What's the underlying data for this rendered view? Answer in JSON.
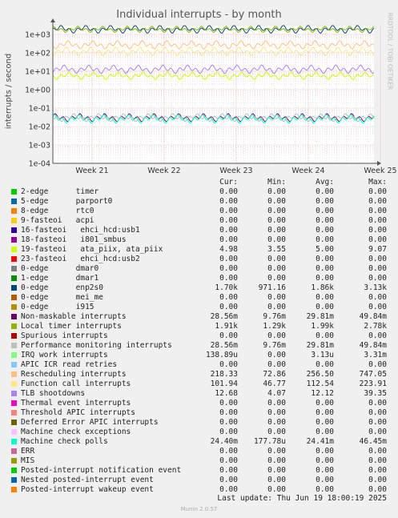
{
  "title": "Individual interrupts - by month",
  "ylabel": "interrupts / second",
  "watermark": "RRDTOOL / TOBI OETIKER",
  "columns": {
    "cur": "Cur:",
    "min": "Min:",
    "avg": "Avg:",
    "max": "Max:"
  },
  "chart_data": {
    "type": "line",
    "title": "Individual interrupts - by month",
    "ylabel": "interrupts / second",
    "xlabel": "",
    "yscale": "log",
    "ylim": [
      0.0001,
      3000
    ],
    "yticks": [
      "1e-04",
      "1e-03",
      "1e-02",
      "1e-01",
      "1e+00",
      "1e+01",
      "1e+02",
      "1e+03"
    ],
    "xticks": [
      "Week 21",
      "Week 22",
      "Week 23",
      "Week 24",
      "Week 25"
    ],
    "grid": true,
    "series": [
      {
        "name": "2-edge      timer",
        "color": "#00cc00",
        "cur": "0.00",
        "min": "0.00",
        "avg": "0.00",
        "max": "0.00"
      },
      {
        "name": "5-edge      parport0",
        "color": "#0066b3",
        "cur": "0.00",
        "min": "0.00",
        "avg": "0.00",
        "max": "0.00"
      },
      {
        "name": "8-edge      rtc0",
        "color": "#ff8000",
        "cur": "0.00",
        "min": "0.00",
        "avg": "0.00",
        "max": "0.00"
      },
      {
        "name": "9-fasteoi   acpi",
        "color": "#ffcc00",
        "cur": "0.00",
        "min": "0.00",
        "avg": "0.00",
        "max": "0.00"
      },
      {
        "name": "16-fasteoi   ehci_hcd:usb1",
        "color": "#330099",
        "cur": "0.00",
        "min": "0.00",
        "avg": "0.00",
        "max": "0.00"
      },
      {
        "name": "18-fasteoi   i801_smbus",
        "color": "#990099",
        "cur": "0.00",
        "min": "0.00",
        "avg": "0.00",
        "max": "0.00"
      },
      {
        "name": "19-fasteoi   ata_piix, ata_piix",
        "color": "#ccff00",
        "cur": "4.98",
        "min": "3.55",
        "avg": "5.00",
        "max": "9.07"
      },
      {
        "name": "23-fasteoi   ehci_hcd:usb2",
        "color": "#ff0000",
        "cur": "0.00",
        "min": "0.00",
        "avg": "0.00",
        "max": "0.00"
      },
      {
        "name": "0-edge      dmar0",
        "color": "#808080",
        "cur": "0.00",
        "min": "0.00",
        "avg": "0.00",
        "max": "0.00"
      },
      {
        "name": "1-edge      dmar1",
        "color": "#008f00",
        "cur": "0.00",
        "min": "0.00",
        "avg": "0.00",
        "max": "0.00"
      },
      {
        "name": "0-edge      enp2s0",
        "color": "#00487d",
        "cur": "1.70k",
        "min": "971.16",
        "avg": "1.86k",
        "max": "3.13k"
      },
      {
        "name": "0-edge      mei_me",
        "color": "#b35a00",
        "cur": "0.00",
        "min": "0.00",
        "avg": "0.00",
        "max": "0.00"
      },
      {
        "name": "0-edge      i915",
        "color": "#b38f00",
        "cur": "0.00",
        "min": "0.00",
        "avg": "0.00",
        "max": "0.00"
      },
      {
        "name": "Non-maskable interrupts",
        "color": "#6b006b",
        "cur": "28.56m",
        "min": "9.76m",
        "avg": "29.81m",
        "max": "49.84m"
      },
      {
        "name": "Local timer interrupts",
        "color": "#8fb300",
        "cur": "1.91k",
        "min": "1.29k",
        "avg": "1.99k",
        "max": "2.78k"
      },
      {
        "name": "Spurious interrupts",
        "color": "#b30000",
        "cur": "0.00",
        "min": "0.00",
        "avg": "0.00",
        "max": "0.00"
      },
      {
        "name": "Performance monitoring interrupts",
        "color": "#bebebe",
        "cur": "28.56m",
        "min": "9.76m",
        "avg": "29.81m",
        "max": "49.84m"
      },
      {
        "name": "IRQ work interrupts",
        "color": "#80ff80",
        "cur": "138.89u",
        "min": "0.00",
        "avg": "3.13u",
        "max": "3.31m"
      },
      {
        "name": "APIC ICR read retries",
        "color": "#80c9ff",
        "cur": "0.00",
        "min": "0.00",
        "avg": "0.00",
        "max": "0.00"
      },
      {
        "name": "Rescheduling interrupts",
        "color": "#ffc080",
        "cur": "218.33",
        "min": "72.86",
        "avg": "256.50",
        "max": "747.05"
      },
      {
        "name": "Function call interrupts",
        "color": "#ffe680",
        "cur": "101.94",
        "min": "46.77",
        "avg": "112.54",
        "max": "223.91"
      },
      {
        "name": "TLB shootdowns",
        "color": "#aa80ff",
        "cur": "12.68",
        "min": "4.07",
        "avg": "12.12",
        "max": "39.35"
      },
      {
        "name": "Thermal event interrupts",
        "color": "#ee00cc",
        "cur": "0.00",
        "min": "0.00",
        "avg": "0.00",
        "max": "0.00"
      },
      {
        "name": "Threshold APIC interrupts",
        "color": "#ff8080",
        "cur": "0.00",
        "min": "0.00",
        "avg": "0.00",
        "max": "0.00"
      },
      {
        "name": "Deferred Error APIC interrupts",
        "color": "#666600",
        "cur": "0.00",
        "min": "0.00",
        "avg": "0.00",
        "max": "0.00"
      },
      {
        "name": "Machine check exceptions",
        "color": "#ffbfff",
        "cur": "0.00",
        "min": "0.00",
        "avg": "0.00",
        "max": "0.00"
      },
      {
        "name": "Machine check polls",
        "color": "#00ffcc",
        "cur": "24.40m",
        "min": "177.78u",
        "avg": "24.41m",
        "max": "46.45m"
      },
      {
        "name": "ERR",
        "color": "#cc6699",
        "cur": "0.00",
        "min": "0.00",
        "avg": "0.00",
        "max": "0.00"
      },
      {
        "name": "MIS",
        "color": "#999900",
        "cur": "0.00",
        "min": "0.00",
        "avg": "0.00",
        "max": "0.00"
      },
      {
        "name": "Posted-interrupt notification event",
        "color": "#00cc00",
        "cur": "0.00",
        "min": "0.00",
        "avg": "0.00",
        "max": "0.00"
      },
      {
        "name": "Nested posted-interrupt event",
        "color": "#0066b3",
        "cur": "0.00",
        "min": "0.00",
        "avg": "0.00",
        "max": "0.00"
      },
      {
        "name": "Posted-interrupt wakeup event",
        "color": "#ff8000",
        "cur": "0.00",
        "min": "0.00",
        "avg": "0.00",
        "max": "0.00"
      }
    ]
  },
  "last_update": "Last update: Thu Jun 19 18:00:19 2025",
  "footer": "Munin 2.0.57"
}
